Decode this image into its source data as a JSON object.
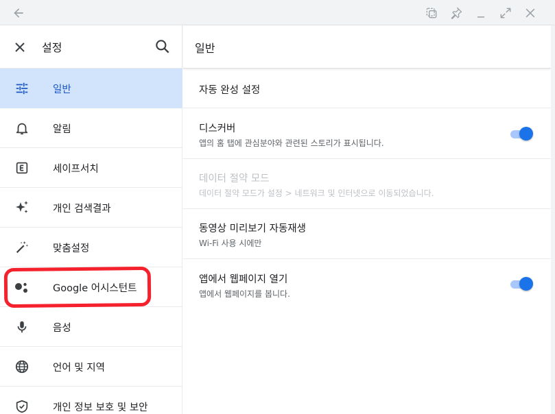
{
  "window": {
    "buttons": [
      "back-icon",
      "screenshot-icon",
      "pin-icon",
      "minimize-icon",
      "maximize-icon",
      "close-icon"
    ]
  },
  "sidebar": {
    "title": "설정",
    "items": [
      {
        "label": "일반",
        "icon": "tune-icon",
        "active": true
      },
      {
        "label": "알림",
        "icon": "bell-icon"
      },
      {
        "label": "세이프서치",
        "icon": "safesearch-icon"
      },
      {
        "label": "개인 검색결과",
        "icon": "sparkle-icon"
      },
      {
        "label": "맞춤설정",
        "icon": "magic-wand-icon"
      },
      {
        "label": "Google 어시스턴트",
        "icon": "assistant-icon"
      },
      {
        "label": "음성",
        "icon": "mic-icon"
      },
      {
        "label": "언어 및 지역",
        "icon": "globe-icon"
      },
      {
        "label": "개인 정보 보호 및 보안",
        "icon": "shield-icon"
      }
    ]
  },
  "main": {
    "title": "일반",
    "rows": [
      {
        "title": "자동 완성 설정"
      },
      {
        "title": "디스커버",
        "subtitle": "앱의 홈 탭에 관심분야와 관련된 스토리가 표시됩니다.",
        "toggle": true
      },
      {
        "title": "데이터 절약 모드",
        "subtitle": "데이터 절약 모드가 설정 > 네트워크 및 인터넷으로 이동되었습니다.",
        "disabled": true
      },
      {
        "title": "동영상 미리보기 자동재생",
        "subtitle": "Wi-Fi 사용 시에만"
      },
      {
        "title": "앱에서 웹페이지 열기",
        "subtitle": "앱에서 웹페이지를 봅니다.",
        "toggle": true
      }
    ]
  },
  "colors": {
    "accent": "#1a73e8",
    "active_bg": "#d2e3fc",
    "annotation": "#f5222d"
  }
}
